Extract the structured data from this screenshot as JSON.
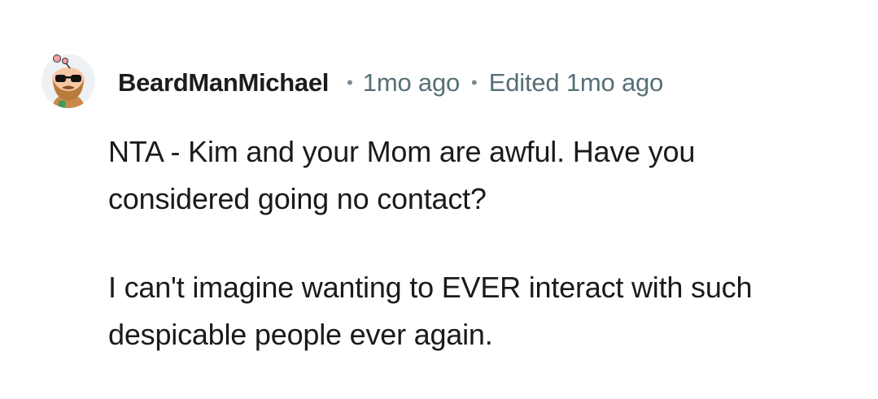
{
  "comment": {
    "author": "BeardManMichael",
    "separator": "•",
    "timestamp": "1mo ago",
    "edited": "Edited 1mo ago",
    "avatar_icon": "snoo-avatar-icon",
    "paragraphs": [
      "NTA - Kim and your Mom are awful. Have you considered going no contact?",
      "I can't imagine wanting to EVER interact with such despicable people ever again."
    ]
  },
  "colors": {
    "username": "#1c1c1c",
    "meta": "#576f76",
    "body": "#1a1a1b",
    "background": "#ffffff"
  }
}
